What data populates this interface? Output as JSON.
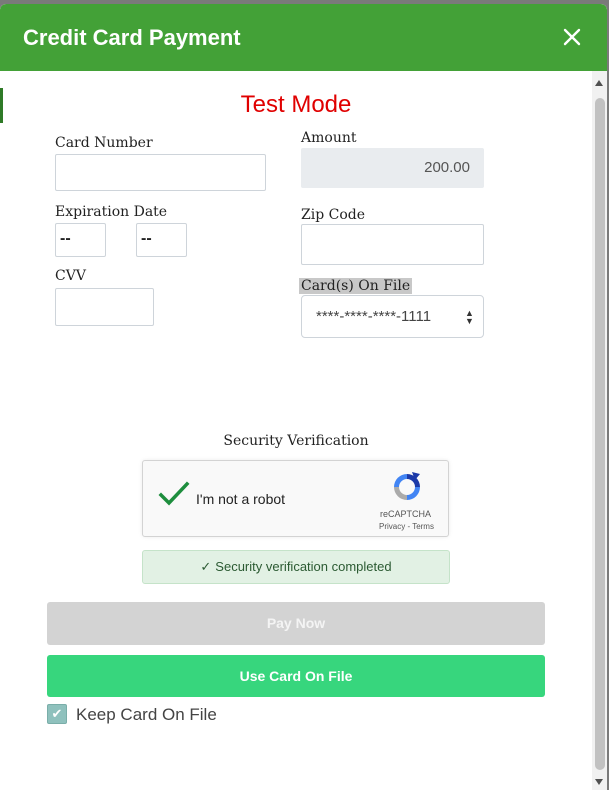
{
  "header": {
    "title": "Credit Card Payment",
    "close_icon": "close-icon"
  },
  "mode_label": "Test Mode",
  "form": {
    "card_number": {
      "label": "Card Number",
      "value": ""
    },
    "amount": {
      "label": "Amount",
      "value": "200.00"
    },
    "expiration": {
      "label": "Expiration Date",
      "month": "--",
      "year": "--"
    },
    "zip": {
      "label": "Zip Code",
      "value": ""
    },
    "cvv": {
      "label": "CVV",
      "value": ""
    },
    "cards_on_file": {
      "label": "Card(s) On File",
      "selected": "****-****-****-1111"
    }
  },
  "security": {
    "title": "Security Verification",
    "captcha_text": "I'm not a robot",
    "captcha_brand": "reCAPTCHA",
    "captcha_links": "Privacy - Terms",
    "captcha_checked": true,
    "status": "Security verification completed"
  },
  "buttons": {
    "pay_now": "Pay Now",
    "use_card_on_file": "Use Card On File"
  },
  "keep_card": {
    "label": "Keep Card On File",
    "checked": true
  },
  "colors": {
    "header": "#43a137",
    "test_mode": "#e00000",
    "use_card_button": "#37d67d",
    "pay_button_disabled": "#d3d3d3"
  }
}
